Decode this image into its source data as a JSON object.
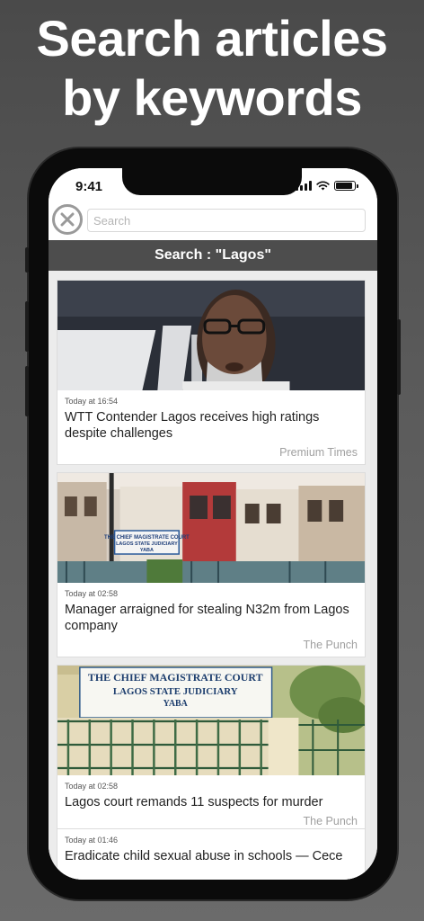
{
  "promo": {
    "line1": "Search articles",
    "line2": "by keywords"
  },
  "status_bar": {
    "time": "9:41",
    "battery_level": 0.9
  },
  "search": {
    "placeholder": "Search",
    "value": "",
    "close_icon": "close-circle-icon"
  },
  "results_header": "Search : \"Lagos\"",
  "articles": [
    {
      "time": "Today at 16:54",
      "title": "WTT Contender Lagos receives high ratings despite challenges",
      "source": "Premium Times",
      "image": "portrait of man with glasses"
    },
    {
      "time": "Today at 02:58",
      "title": "Manager arraigned for stealing N32m from Lagos company",
      "source": "The Punch",
      "image": "chief magistrate court building"
    },
    {
      "time": "Today at 02:58",
      "title": "Lagos court remands 11 suspects for murder",
      "source": "The Punch",
      "image": "court signboard and gate"
    },
    {
      "time": "Today at 01:46",
      "title": "Eradicate child sexual abuse in schools — Cece",
      "source": "",
      "image": ""
    }
  ],
  "court_sign": {
    "line1": "THE CHIEF MAGISTRATE COURT",
    "line2": "LAGOS STATE JUDICIARY",
    "line3": "YABA"
  },
  "colors": {
    "results_bar": "#4d4d4d",
    "feed_background": "#ececec",
    "source_text": "#a0a0a0"
  }
}
